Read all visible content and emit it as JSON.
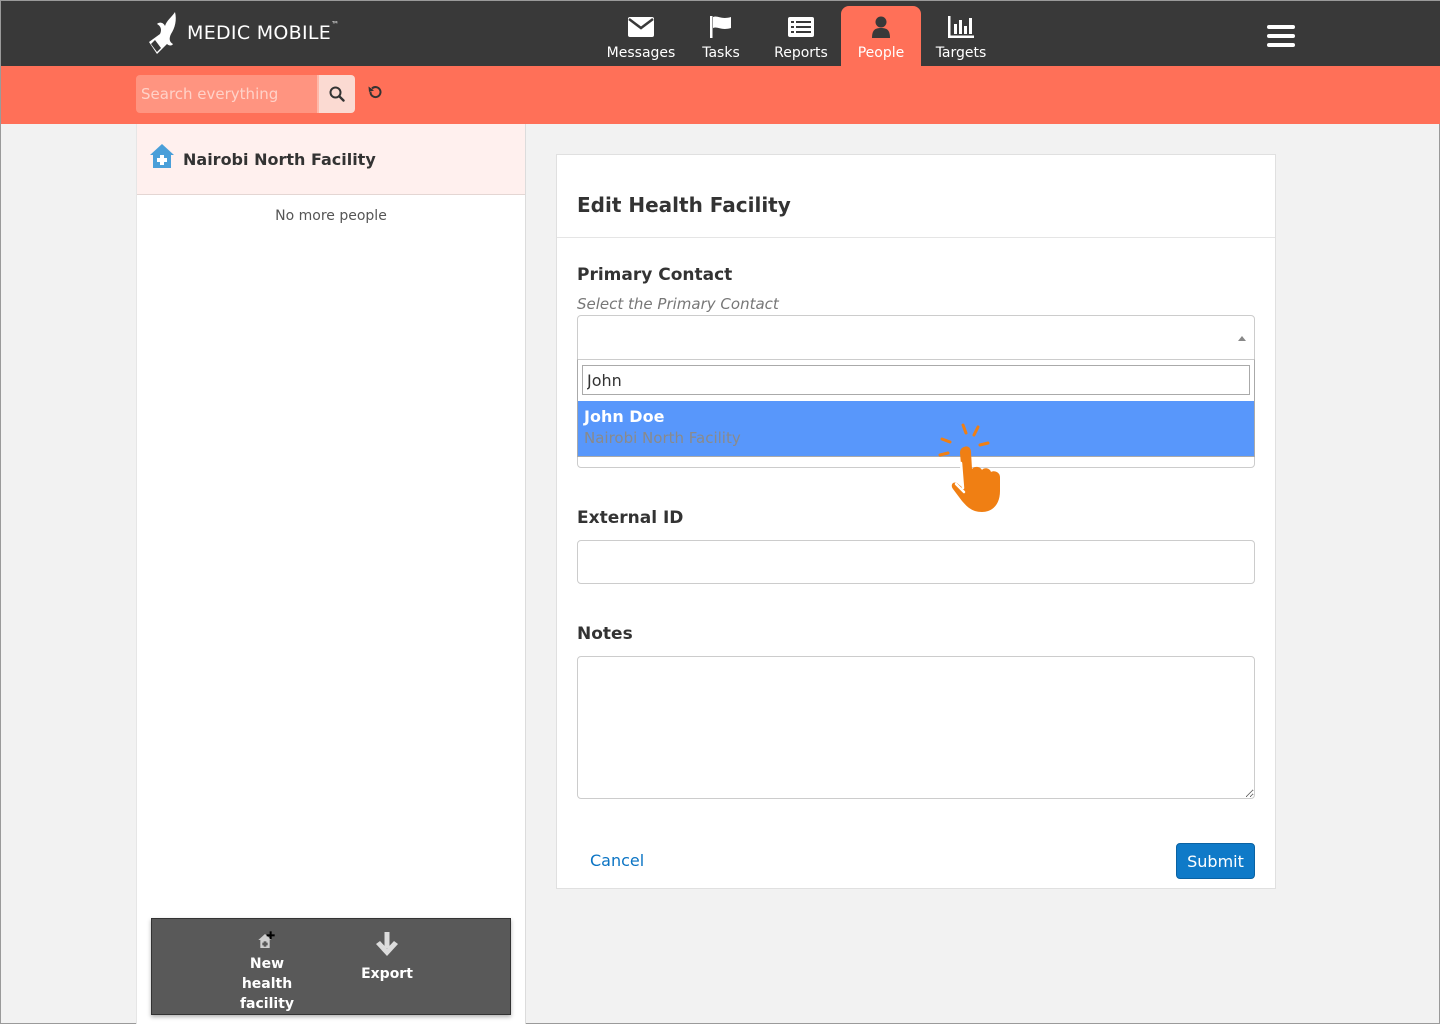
{
  "brand": {
    "name": "MEDIC MOBILE",
    "trademark": "™"
  },
  "nav": {
    "items": [
      {
        "label": "Messages",
        "icon": "envelope-icon"
      },
      {
        "label": "Tasks",
        "icon": "flag-icon"
      },
      {
        "label": "Reports",
        "icon": "list-icon"
      },
      {
        "label": "People",
        "icon": "person-icon",
        "active": true
      },
      {
        "label": "Targets",
        "icon": "bar-chart-icon"
      }
    ]
  },
  "search": {
    "placeholder": "Search everything"
  },
  "list": {
    "facility_name": "Nairobi North Facility",
    "footer_text": "No more people"
  },
  "actions": {
    "new_facility_label": "New health facility",
    "export_label": "Export"
  },
  "form": {
    "title": "Edit Health Facility",
    "primary_contact": {
      "label": "Primary Contact",
      "hint": "Select the Primary Contact",
      "search_value": "John",
      "option_name": "John Doe",
      "option_sub": "Nairobi North Facility"
    },
    "external_id": {
      "label": "External ID",
      "value": ""
    },
    "notes": {
      "label": "Notes",
      "value": ""
    },
    "cancel_label": "Cancel",
    "submit_label": "Submit"
  },
  "colors": {
    "topbar": "#393939",
    "accent": "#ff7058",
    "highlight": "#5897fb",
    "primary_button": "#0f7ac8"
  }
}
